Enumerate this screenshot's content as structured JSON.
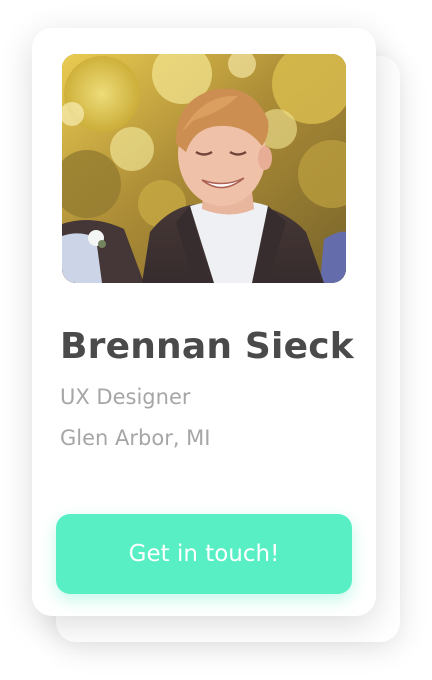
{
  "profile": {
    "name": "Brennan Sieck",
    "role": "UX Designer",
    "location": "Glen Arbor, MI",
    "cta_label": "Get in touch!"
  },
  "theme": {
    "accent": "#58EFC4",
    "name_color": "#4A4A4A",
    "muted_text": "#A6A6A6",
    "card_bg": "#FFFFFF"
  }
}
